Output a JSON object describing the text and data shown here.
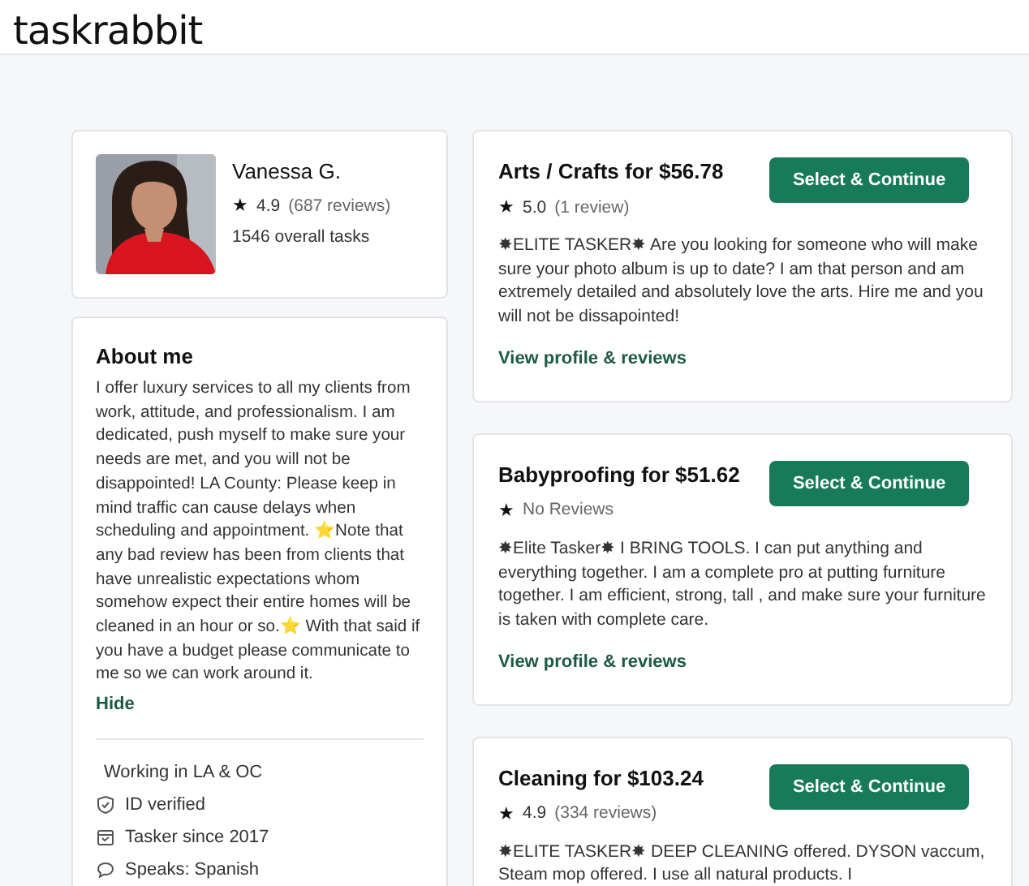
{
  "header": {
    "logo": "taskrabbit"
  },
  "profile": {
    "name": "Vanessa G.",
    "star": "★",
    "rating": "4.9",
    "reviews": "(687 reviews)",
    "tasks": "1546 overall tasks"
  },
  "about": {
    "title": "About me",
    "text": "I offer luxury services to all my clients from work, attitude, and professionalism. I am dedicated, push myself to make sure your needs are met, and you will not be disappointed! LA County: Please keep in mind traffic can cause delays when scheduling and appointment. ⭐Note that any bad review has been from clients that have unrealistic expectations whom somehow expect their entire homes will be cleaned in an hour or so.⭐ With that said if you have a budget please communicate to me so we can work around it.",
    "toggle": "Hide",
    "facts": [
      {
        "kind": "none",
        "text": "Working in LA & OC"
      },
      {
        "kind": "shield",
        "text": "ID verified"
      },
      {
        "kind": "calendar",
        "text": "Tasker since 2017"
      },
      {
        "kind": "chat",
        "text": "Speaks: Spanish"
      }
    ]
  },
  "services": [
    {
      "title": "Arts / Crafts for $56.78",
      "star": "★",
      "rating": "5.0",
      "reviews": "(1 review)",
      "button": "Select & Continue",
      "description": "✸ELITE TASKER✸ Are you looking for someone who will make sure your photo album is up to date? I am that person and am extremely detailed and absolutely love the arts. Hire me and you will not be dissapointed!",
      "link": "View profile & reviews"
    },
    {
      "title": "Babyproofing for $51.62",
      "star": "★",
      "reviews": "No Reviews",
      "button": "Select & Continue",
      "description": "✸Elite Tasker✸ I BRING TOOLS. I can put anything and everything together. I am a complete pro at putting furniture together. I am efficient, strong, tall , and make sure your furniture is taken with complete care.",
      "link": "View profile & reviews"
    },
    {
      "title": "Cleaning for $103.24",
      "star": "★",
      "rating": "4.9",
      "reviews": "(334 reviews)",
      "button": "Select & Continue",
      "description": "✸ELITE TASKER✸ DEEP CLEANING offered. DYSON vaccum, Steam mop offered. I use all natural products. I"
    }
  ]
}
